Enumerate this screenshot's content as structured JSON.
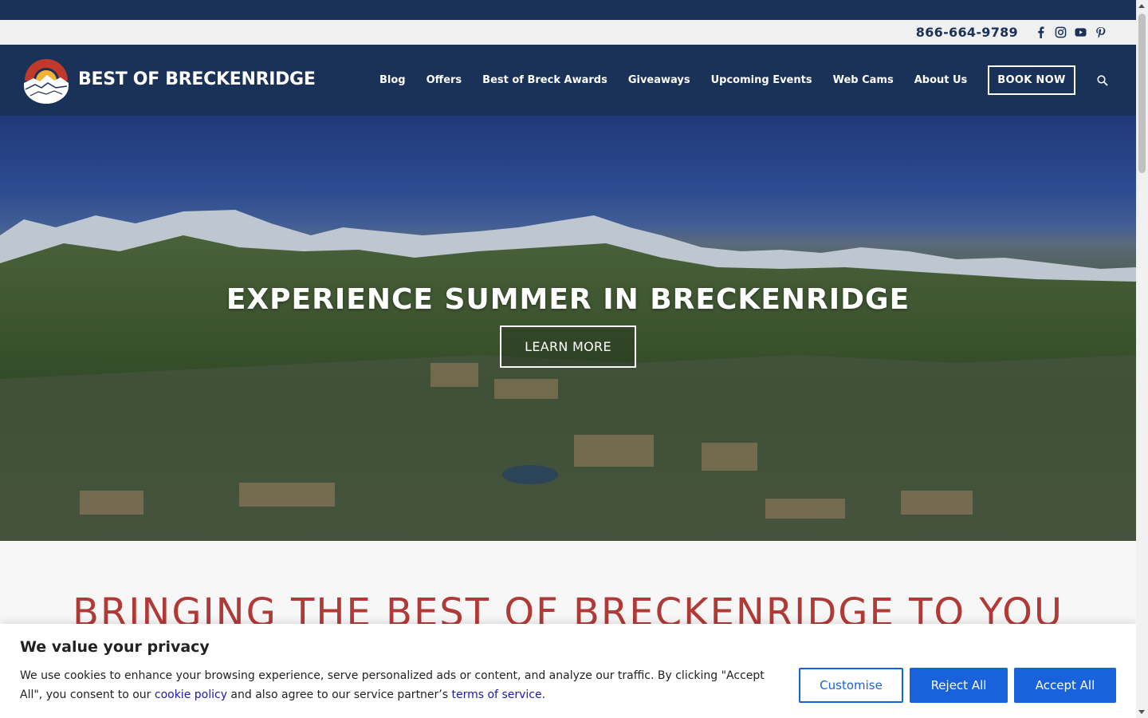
{
  "contact": {
    "phone": "866-664-9789"
  },
  "social": [
    "facebook-icon",
    "instagram-icon",
    "youtube-icon",
    "pinterest-icon"
  ],
  "brand": {
    "name": "BEST OF BRECKENRIDGE"
  },
  "nav": {
    "items": [
      "Blog",
      "Offers",
      "Best of Breck Awards",
      "Giveaways",
      "Upcoming Events",
      "Web Cams",
      "About Us"
    ],
    "cta": "BOOK NOW"
  },
  "hero": {
    "title": "EXPERIENCE SUMMER IN BRECKENRIDGE",
    "button": "LEARN MORE"
  },
  "section": {
    "title": "BRINGING THE BEST OF BRECKENRIDGE TO YOU"
  },
  "cookie": {
    "title": "We value your privacy",
    "text_1": "We use cookies to enhance your browsing experience, serve personalized ads or content, and analyze our traffic. By clicking \"Accept All\", you consent to our ",
    "link_1": "cookie policy",
    "text_2": " and also agree to our service partner’s ",
    "link_2": "terms of service",
    "text_3": ".",
    "customise": "Customise",
    "reject": "Reject All",
    "accept": "Accept All"
  },
  "colors": {
    "navy": "#1b3258",
    "red": "#b23a36",
    "blue": "#1863dc"
  }
}
